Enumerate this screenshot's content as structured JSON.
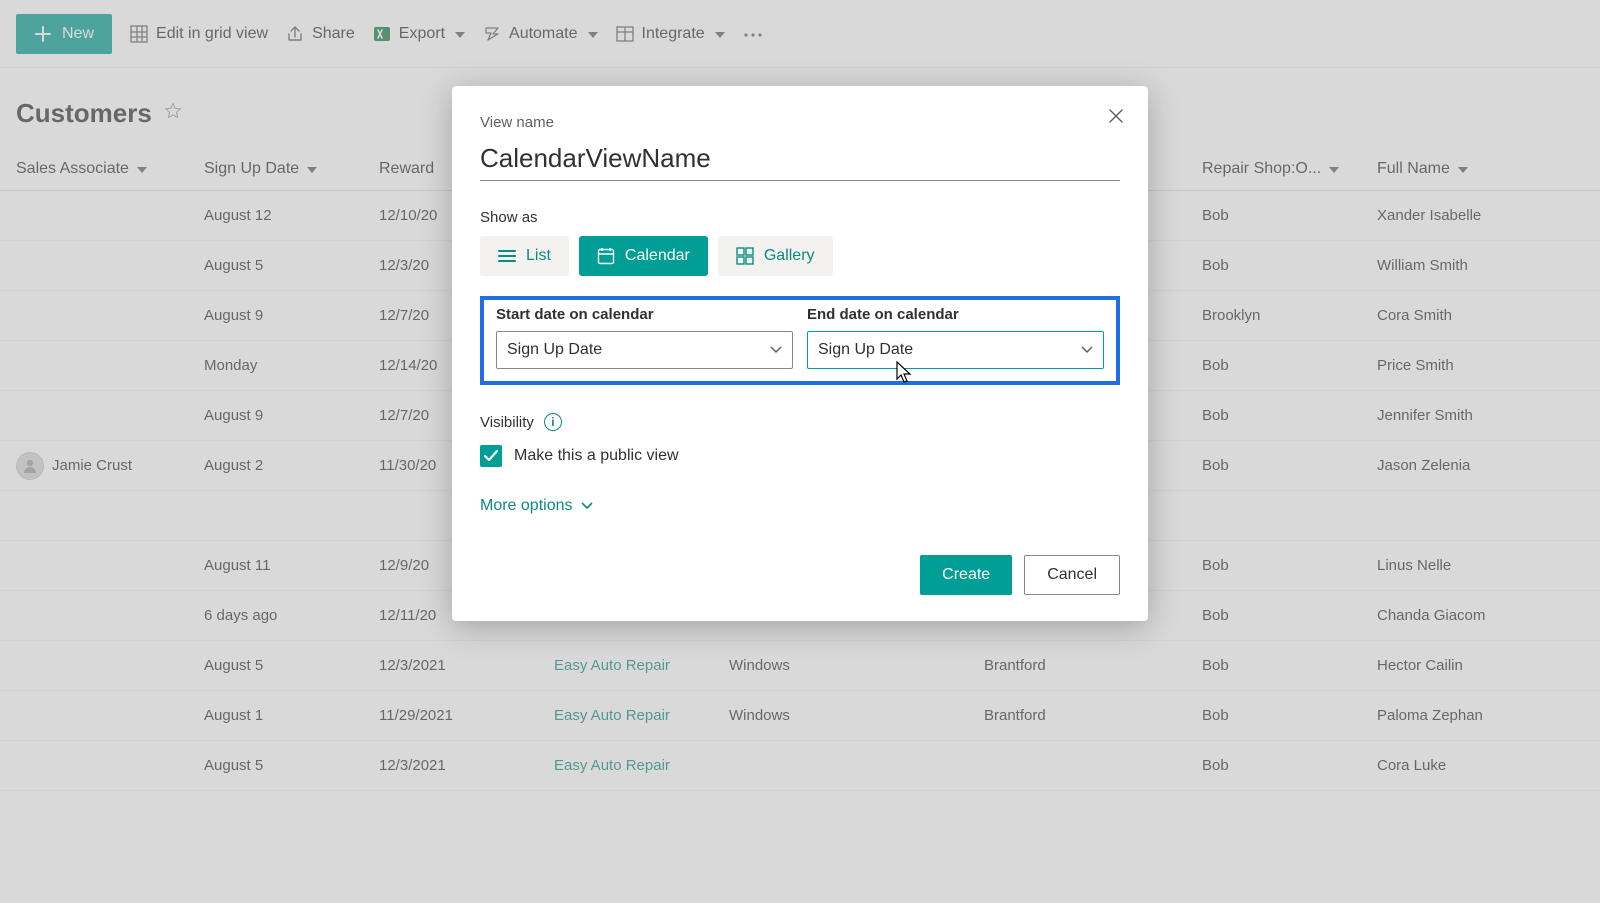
{
  "toolbar": {
    "new_label": "New",
    "edit_grid_label": "Edit in grid view",
    "share_label": "Share",
    "export_label": "Export",
    "automate_label": "Automate",
    "integrate_label": "Integrate"
  },
  "page": {
    "title": "Customers"
  },
  "columns": {
    "sales": "Sales Associate",
    "signup": "Sign Up Date",
    "reward": "Reward",
    "shop": "",
    "service": "",
    "city": "",
    "repair": "Repair Shop:O...",
    "fullname": "Full Name"
  },
  "rows": [
    {
      "sales": "",
      "signup": "August 12",
      "reward": "12/10/20",
      "shop": "",
      "service": "",
      "city": "",
      "repair": "Bob",
      "fullname": "Xander Isabelle"
    },
    {
      "sales": "",
      "signup": "August 5",
      "reward": "12/3/20",
      "shop": "",
      "service": "",
      "city": "",
      "repair": "Bob",
      "fullname": "William Smith"
    },
    {
      "sales": "",
      "signup": "August 9",
      "reward": "12/7/20",
      "shop": "",
      "service": "",
      "city": "",
      "repair": "Brooklyn",
      "fullname": "Cora Smith"
    },
    {
      "sales": "",
      "signup": "Monday",
      "reward": "12/14/20",
      "shop": "",
      "service": "",
      "city": "",
      "repair": "Bob",
      "fullname": "Price Smith"
    },
    {
      "sales": "",
      "signup": "August 9",
      "reward": "12/7/20",
      "shop": "",
      "service": "",
      "city": "",
      "repair": "Bob",
      "fullname": "Jennifer Smith"
    },
    {
      "sales": "Jamie Crust",
      "sales_avatar": true,
      "signup": "August 2",
      "reward": "11/30/20",
      "shop": "",
      "service": "",
      "city": "",
      "repair": "Bob",
      "fullname": "Jason Zelenia"
    },
    {
      "sales": "",
      "signup": "",
      "reward": "",
      "shop": "",
      "service": "",
      "city": "",
      "repair": "",
      "fullname": ""
    },
    {
      "sales": "",
      "signup": "August 11",
      "reward": "12/9/20",
      "shop": "",
      "service": "",
      "city": "",
      "repair": "Bob",
      "fullname": "Linus Nelle"
    },
    {
      "sales": "",
      "signup": "6 days ago",
      "reward": "12/11/20",
      "shop": "",
      "service": "",
      "city": "",
      "repair": "Bob",
      "fullname": "Chanda Giacom"
    },
    {
      "sales": "",
      "signup": "August 5",
      "reward": "12/3/2021",
      "shop": "Easy Auto Repair",
      "service": "Windows",
      "city": "Brantford",
      "repair": "Bob",
      "fullname": "Hector Cailin"
    },
    {
      "sales": "",
      "signup": "August 1",
      "reward": "11/29/2021",
      "shop": "Easy Auto Repair",
      "service": "Windows",
      "city": "Brantford",
      "repair": "Bob",
      "fullname": "Paloma Zephan"
    },
    {
      "sales": "",
      "signup": "August 5",
      "reward": "12/3/2021",
      "shop": "Easy Auto Repair",
      "service": "",
      "city": "",
      "repair": "Bob",
      "fullname": "Cora Luke"
    }
  ],
  "dialog": {
    "viewname_label": "View name",
    "viewname_value": "CalendarViewName",
    "showas_label": "Show as",
    "pill_list": "List",
    "pill_calendar": "Calendar",
    "pill_gallery": "Gallery",
    "start_label": "Start date on calendar",
    "start_value": "Sign Up Date",
    "end_label": "End date on calendar",
    "end_value": "Sign Up Date",
    "visibility_label": "Visibility",
    "public_label": "Make this a public view",
    "more_options": "More options",
    "create_label": "Create",
    "cancel_label": "Cancel"
  }
}
